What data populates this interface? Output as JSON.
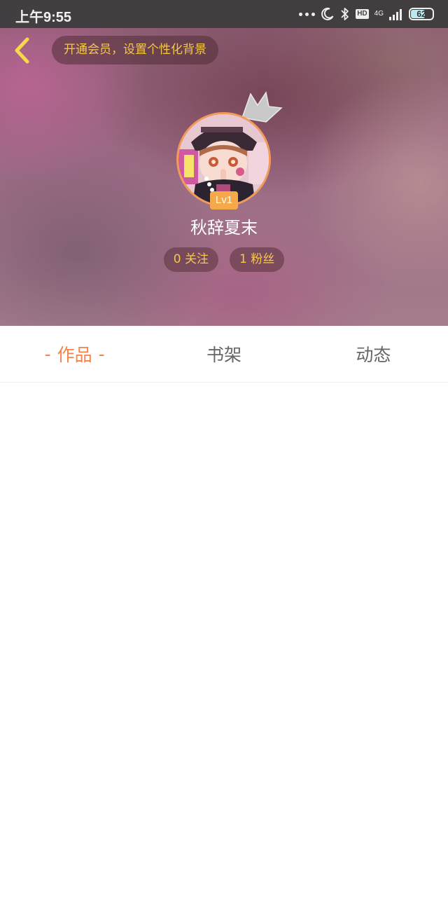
{
  "status_bar": {
    "time": "上午9:55",
    "network": "4G",
    "hd_label": "HD",
    "battery_percent": "62",
    "icons": [
      "more-dots-icon",
      "moon-icon",
      "bluetooth-icon",
      "hd-icon",
      "signal-icon",
      "battery-icon"
    ]
  },
  "header": {
    "back_icon": "chevron-left-icon",
    "vip_banner": "开通会员，设置个性化背景"
  },
  "profile": {
    "username": "秋辞夏末",
    "level": "Lv1",
    "following": "0 关注",
    "followers": "1 粉丝"
  },
  "tabs": [
    {
      "label": "作品",
      "active": true
    },
    {
      "label": "书架",
      "active": false
    },
    {
      "label": "动态",
      "active": false
    }
  ],
  "colors": {
    "accent": "#f0844a",
    "gold_text": "#f5c84a",
    "level_badge": "#f5a94a"
  }
}
